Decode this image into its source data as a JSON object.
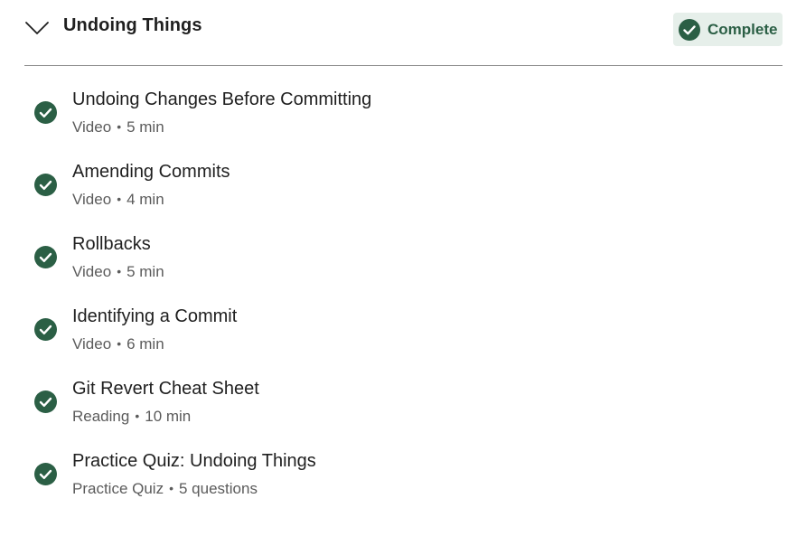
{
  "module": {
    "title": "Undoing Things",
    "status_label": "Complete",
    "expand_icon": "chevron-down-icon",
    "status_icon": "check-circle-icon",
    "accent_color": "#2b5f45",
    "badge_background": "#e6efea"
  },
  "items": [
    {
      "title": "Undoing Changes Before Committing",
      "type": "Video",
      "separator": "•",
      "duration": "5 min",
      "icon": "check-circle-icon"
    },
    {
      "title": "Amending Commits",
      "type": "Video",
      "separator": "•",
      "duration": "4 min",
      "icon": "check-circle-icon"
    },
    {
      "title": "Rollbacks",
      "type": "Video",
      "separator": "•",
      "duration": "5 min",
      "icon": "check-circle-icon"
    },
    {
      "title": "Identifying a Commit",
      "type": "Video",
      "separator": "•",
      "duration": "6 min",
      "icon": "check-circle-icon"
    },
    {
      "title": "Git Revert Cheat Sheet",
      "type": "Reading",
      "separator": "•",
      "duration": "10 min",
      "icon": "check-circle-icon"
    },
    {
      "title": "Practice Quiz: Undoing Things",
      "type": "Practice Quiz",
      "separator": "•",
      "duration": "5 questions",
      "icon": "check-circle-icon"
    }
  ]
}
